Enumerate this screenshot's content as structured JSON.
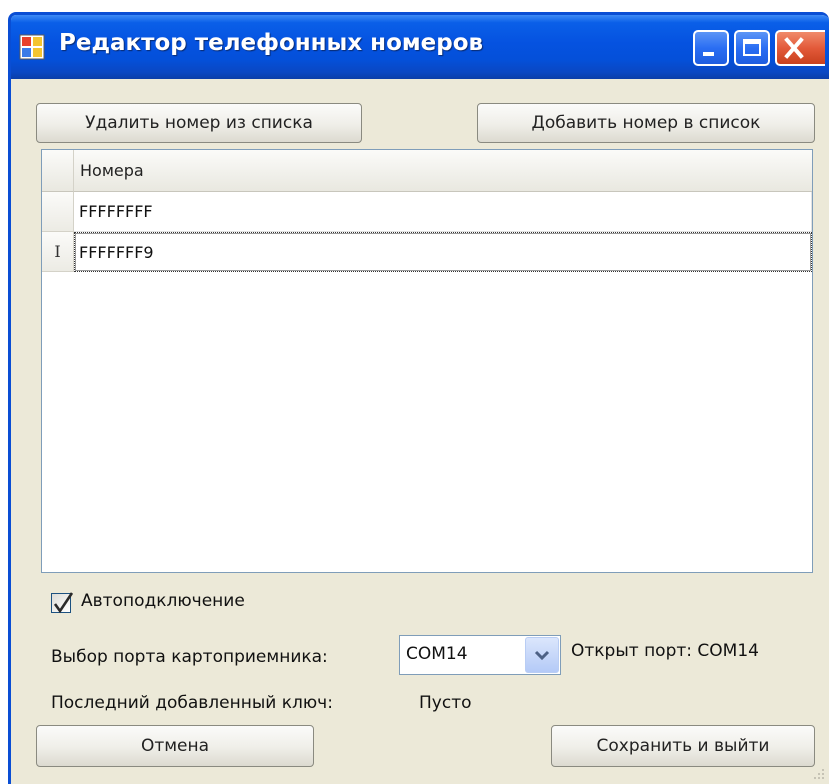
{
  "window": {
    "title": "Редактор телефонных номеров",
    "accent_color": "#0a4ed4",
    "icons": [
      "app-icon",
      "minimize-icon",
      "maximize-icon",
      "close-icon"
    ]
  },
  "toolbar": {
    "delete_label": "Удалить номер из списка",
    "add_label": "Добавить номер в список"
  },
  "grid": {
    "column_header": "Номера",
    "rows": [
      {
        "value": "FFFFFFFF"
      },
      {
        "value": "FFFFFFF9",
        "editing_marker": "I"
      }
    ]
  },
  "options": {
    "autoconnect_label": "Автоподключение",
    "autoconnect_checked": true,
    "port_label": "Выбор порта картоприемника:",
    "port_value": "COM14",
    "port_status": "Открыт порт: COM14",
    "last_key_label": "Последний добавленный ключ:",
    "last_key_value": "Пусто"
  },
  "footer": {
    "cancel_label": "Отмена",
    "save_label": "Сохранить и выйти"
  }
}
